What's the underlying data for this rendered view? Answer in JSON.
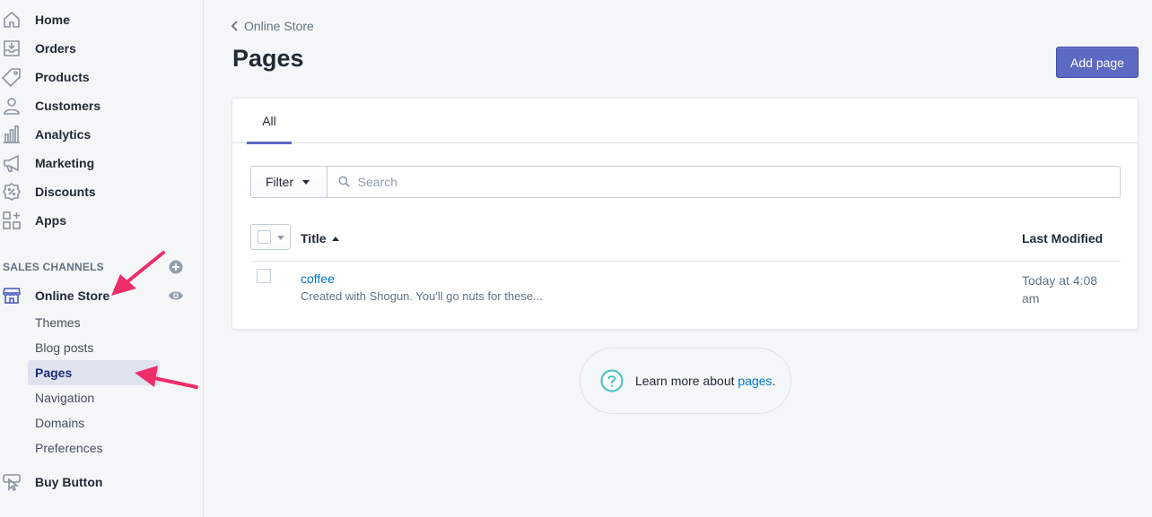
{
  "sidebar": {
    "items": [
      {
        "label": "Home",
        "icon": "home-icon"
      },
      {
        "label": "Orders",
        "icon": "orders-icon"
      },
      {
        "label": "Products",
        "icon": "tag-icon"
      },
      {
        "label": "Customers",
        "icon": "person-icon"
      },
      {
        "label": "Analytics",
        "icon": "bar-chart-icon"
      },
      {
        "label": "Marketing",
        "icon": "megaphone-icon"
      },
      {
        "label": "Discounts",
        "icon": "discount-icon"
      },
      {
        "label": "Apps",
        "icon": "apps-icon"
      }
    ],
    "sales_channels_title": "SALES CHANNELS",
    "online_store_label": "Online Store",
    "sub_items": [
      "Themes",
      "Blog posts",
      "Pages",
      "Navigation",
      "Domains",
      "Preferences"
    ],
    "active_sub_item": "Pages",
    "buy_button_label": "Buy Button"
  },
  "header": {
    "breadcrumb": "Online Store",
    "title": "Pages",
    "add_button": "Add page"
  },
  "card": {
    "tabs": [
      {
        "label": "All",
        "active": true
      }
    ],
    "filter_label": "Filter",
    "search_placeholder": "Search",
    "columns": {
      "title": "Title",
      "last_modified": "Last Modified"
    },
    "rows": [
      {
        "title": "coffee",
        "excerpt": "Created with Shogun. You'll go nuts for these...",
        "last_modified": "Today at 4:08 am"
      }
    ]
  },
  "help": {
    "text": "Learn more about",
    "link": "pages",
    "suffix": "."
  },
  "colors": {
    "accent": "#5c6ac4",
    "link": "#007ace",
    "annotation_arrow": "#ee2e6b",
    "help_icon": "#47c1bf"
  }
}
